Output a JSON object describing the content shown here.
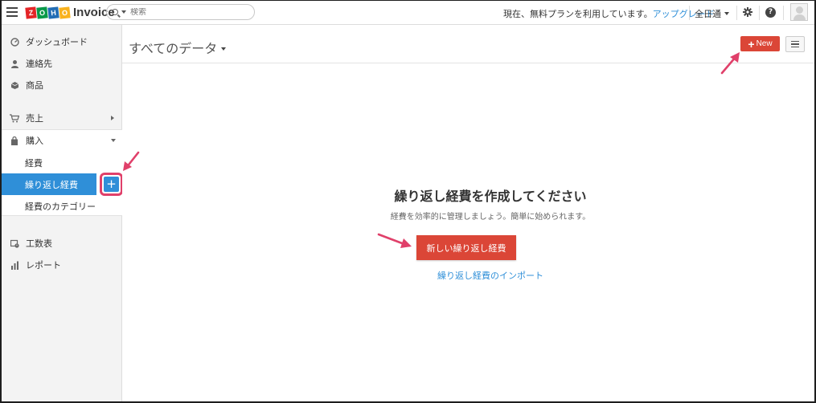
{
  "topbar": {
    "logo_letters": [
      "Z",
      "O",
      "H",
      "O"
    ],
    "logo_colors": [
      "#e42527",
      "#089949",
      "#226db4",
      "#f9b21d"
    ],
    "app_name": "Invoice",
    "search_placeholder": "検索",
    "plan_text": "現在、無料プランを利用しています。",
    "upgrade_label": "アップグレード",
    "org_name": "全日通",
    "help_label": "?"
  },
  "sidebar": {
    "items": [
      {
        "label": "ダッシュボード",
        "icon": "dashboard-icon"
      },
      {
        "label": "連絡先",
        "icon": "contacts-icon"
      },
      {
        "label": "商品",
        "icon": "items-icon"
      },
      {
        "label": "売上",
        "icon": "cart-icon"
      },
      {
        "label": "購入",
        "icon": "bag-icon"
      },
      {
        "label": "工数表",
        "icon": "timesheet-icon"
      },
      {
        "label": "レポート",
        "icon": "reports-icon"
      }
    ],
    "purchase_sub": [
      {
        "label": "経費"
      },
      {
        "label": "繰り返し経費"
      },
      {
        "label": "経費のカテゴリー"
      }
    ],
    "add_label": "+"
  },
  "main": {
    "view_title": "すべてのデータ",
    "new_button": "New",
    "empty_title": "繰り返し経費を作成してください",
    "empty_desc": "経費を効率的に管理しましょう。簡単に始められます。",
    "cta_label": "新しい繰り返し経費",
    "import_label": "繰り返し経費のインポート"
  },
  "colors": {
    "accent": "#2f8fd8",
    "primary_button": "#db4637",
    "annotation": "#e0406a"
  }
}
